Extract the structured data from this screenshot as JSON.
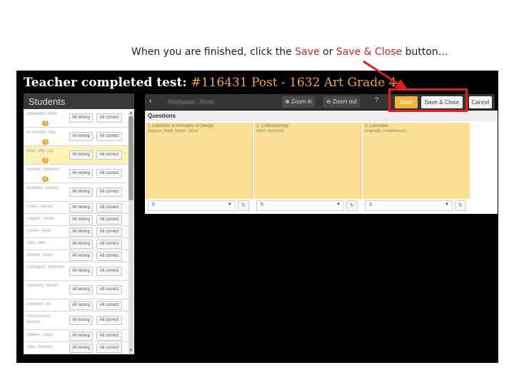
{
  "caption": {
    "part1": "When you are finished, click the ",
    "save": "Save",
    "or": " or ",
    "save_close": "Save & Close",
    "end": " button…"
  },
  "window": {
    "title_prefix": "Teacher completed test: ",
    "title_test": "#116431 Post - 1632 Art Grade 4"
  },
  "students_panel": {
    "header": "Students",
    "all_wrong_label": "All wrong",
    "all_correct_label": "All correct",
    "rows": [
      {
        "name": "Abdisalan, Ibrah",
        "badge": "3"
      },
      {
        "name": "Al Shuaibi, Raji",
        "badge": "3"
      },
      {
        "name": "Alsa, Jillie Cla",
        "badge": "3"
      },
      {
        "name": "Alorock, Hamnrin",
        "badge": "3"
      },
      {
        "name": "Bhattara, Suman",
        "badge": ""
      },
      {
        "name": "Coles, Haines",
        "badge": ""
      },
      {
        "name": "Copper, Janae",
        "badge": ""
      },
      {
        "name": "Coven, Ryan",
        "badge": ""
      },
      {
        "name": "Dahl, Alex",
        "badge": ""
      },
      {
        "name": "Dhakal, Sujan",
        "badge": ""
      },
      {
        "name": "Eddington, Brandon",
        "badge": ""
      },
      {
        "name": "Ellsworth, Micah",
        "badge": ""
      },
      {
        "name": "Ebrahem, Ali",
        "badge": ""
      },
      {
        "name": "Fitzsimmons, Markus",
        "badge": ""
      },
      {
        "name": "Gaines, Tayla",
        "badge": ""
      },
      {
        "name": "Glan, Namme",
        "badge": ""
      }
    ]
  },
  "toolbar": {
    "back": "‹",
    "student_name": "Abdisalan, Ibrah",
    "zoom_in": "Zoom in",
    "zoom_out": "Zoom out",
    "help": "?",
    "save": "Save",
    "save_close": "Save & Close",
    "cancel": "Cancel"
  },
  "questions": {
    "header": "Questions",
    "items": [
      {
        "title": "1. Elements & Principles of Design",
        "subtitle": "(balance, shape, texture, value)",
        "score": "5"
      },
      {
        "title": "2. Craftsmanship",
        "subtitle": "(effort, neatness)",
        "score": "5"
      },
      {
        "title": "3. Execution",
        "subtitle": "(originality, completeness)",
        "score": "3"
      }
    ]
  },
  "colors": {
    "accent_orange": "#f4b43a",
    "highlight_red": "#e01e1e",
    "question_yellow": "#fbdf94"
  }
}
